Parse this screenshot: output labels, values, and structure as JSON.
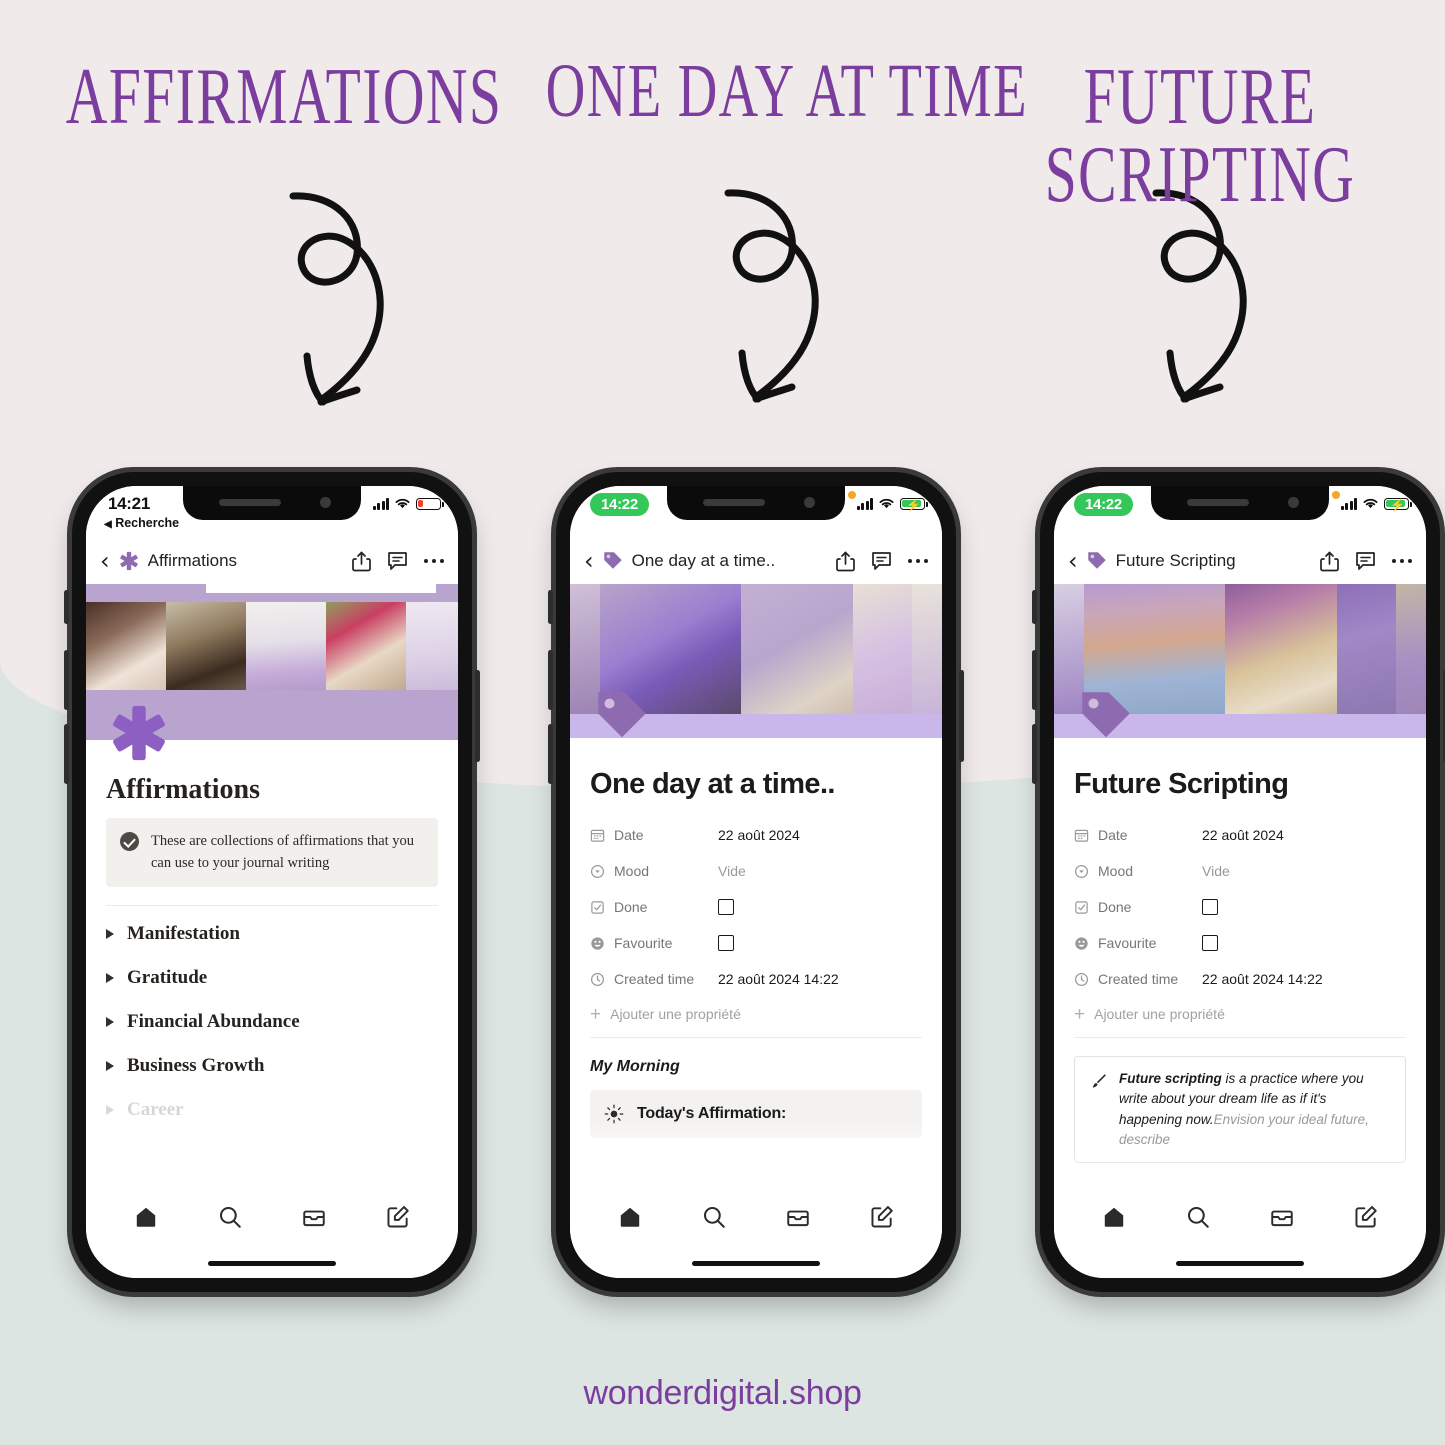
{
  "headings": {
    "h1": "AFFIRMATIONS",
    "h2": "ONE DAY AT TIME",
    "h3": "FUTURE SCRIPTING"
  },
  "footer": {
    "text": "wonderdigital.shop"
  },
  "colors": {
    "bg_top": "#f0eaea",
    "bg_bottom": "#dde5e2",
    "purple_heading": "#7B3D9E",
    "cover_band": "#b8a4cf",
    "cover_band_light": "#c9b6ea",
    "icon_purple": "#8e6bb0",
    "green_badge": "#34C759",
    "battery_low": "#FF3B30"
  },
  "phones": [
    {
      "id": "phone-affirmations",
      "status": {
        "time": "14:21",
        "time_style": "plain",
        "back_label": "Recherche",
        "battery": "low",
        "orange_dot": false
      },
      "nav": {
        "title": "Affirmations",
        "icon": "asterisk-icon",
        "back_icon": "chevron-left-icon",
        "share_icon": "share-icon",
        "comment_icon": "comment-icon",
        "more_icon": "more-dots-icon"
      },
      "page": {
        "title": "Affirmations",
        "title_font": "serif",
        "callout": {
          "icon": "check-circle-icon",
          "text": "These are collections of affirmations that you can use to your journal writing"
        },
        "toggles": [
          {
            "label": "Manifestation",
            "faded": false
          },
          {
            "label": "Gratitude",
            "faded": false
          },
          {
            "label": "Financial Abundance",
            "faded": false
          },
          {
            "label": "Business Growth",
            "faded": false
          },
          {
            "label": "Career",
            "faded": true
          }
        ]
      }
    },
    {
      "id": "phone-one-day",
      "status": {
        "time": "14:22",
        "time_style": "pill",
        "back_label": "",
        "battery": "charge",
        "orange_dot": true
      },
      "nav": {
        "title": "One day at a time..",
        "icon": "tag-icon",
        "back_icon": "chevron-left-icon",
        "share_icon": "share-icon",
        "comment_icon": "comment-icon",
        "more_icon": "more-dots-icon"
      },
      "page": {
        "title": "One day at a time..",
        "title_font": "sans",
        "properties": [
          {
            "icon": "calendar-icon",
            "name": "Date",
            "value": "22 août 2024",
            "type": "text"
          },
          {
            "icon": "select-icon",
            "name": "Mood",
            "value": "Vide",
            "type": "empty"
          },
          {
            "icon": "checkbox-icon",
            "name": "Done",
            "value": "",
            "type": "checkbox"
          },
          {
            "icon": "smiley-icon",
            "name": "Favourite",
            "value": "",
            "type": "checkbox"
          },
          {
            "icon": "clock-icon",
            "name": "Created time",
            "value": "22 août 2024 14:22",
            "type": "text"
          }
        ],
        "add_property": "Ajouter une propriété",
        "section_heading": "My Morning",
        "affirmation_box": {
          "icon": "sun-icon",
          "label": "Today's Affirmation:"
        }
      }
    },
    {
      "id": "phone-future-scripting",
      "status": {
        "time": "14:22",
        "time_style": "pill",
        "back_label": "",
        "battery": "charge",
        "orange_dot": true
      },
      "nav": {
        "title": "Future Scripting",
        "icon": "tag-icon",
        "back_icon": "chevron-left-icon",
        "share_icon": "share-icon",
        "comment_icon": "comment-icon",
        "more_icon": "more-dots-icon"
      },
      "page": {
        "title": "Future Scripting",
        "title_font": "sans",
        "properties": [
          {
            "icon": "calendar-icon",
            "name": "Date",
            "value": "22 août 2024",
            "type": "text"
          },
          {
            "icon": "select-icon",
            "name": "Mood",
            "value": "Vide",
            "type": "empty"
          },
          {
            "icon": "checkbox-icon",
            "name": "Done",
            "value": "",
            "type": "checkbox"
          },
          {
            "icon": "smiley-icon",
            "name": "Favourite",
            "value": "",
            "type": "checkbox"
          },
          {
            "icon": "clock-icon",
            "name": "Created time",
            "value": "22 août 2024 14:22",
            "type": "text"
          }
        ],
        "add_property": "Ajouter une propriété",
        "callout": {
          "icon": "paintbrush-icon",
          "bold_lead": "Future scripting",
          "text": " is a practice where you write about your dream life as if it's happening now.",
          "faded_text": "Envision your ideal future, describe"
        }
      }
    }
  ],
  "bottom_nav": {
    "items": [
      {
        "icon": "home-icon",
        "name": "home"
      },
      {
        "icon": "search-icon",
        "name": "search"
      },
      {
        "icon": "inbox-icon",
        "name": "inbox"
      },
      {
        "icon": "compose-icon",
        "name": "compose"
      }
    ]
  }
}
